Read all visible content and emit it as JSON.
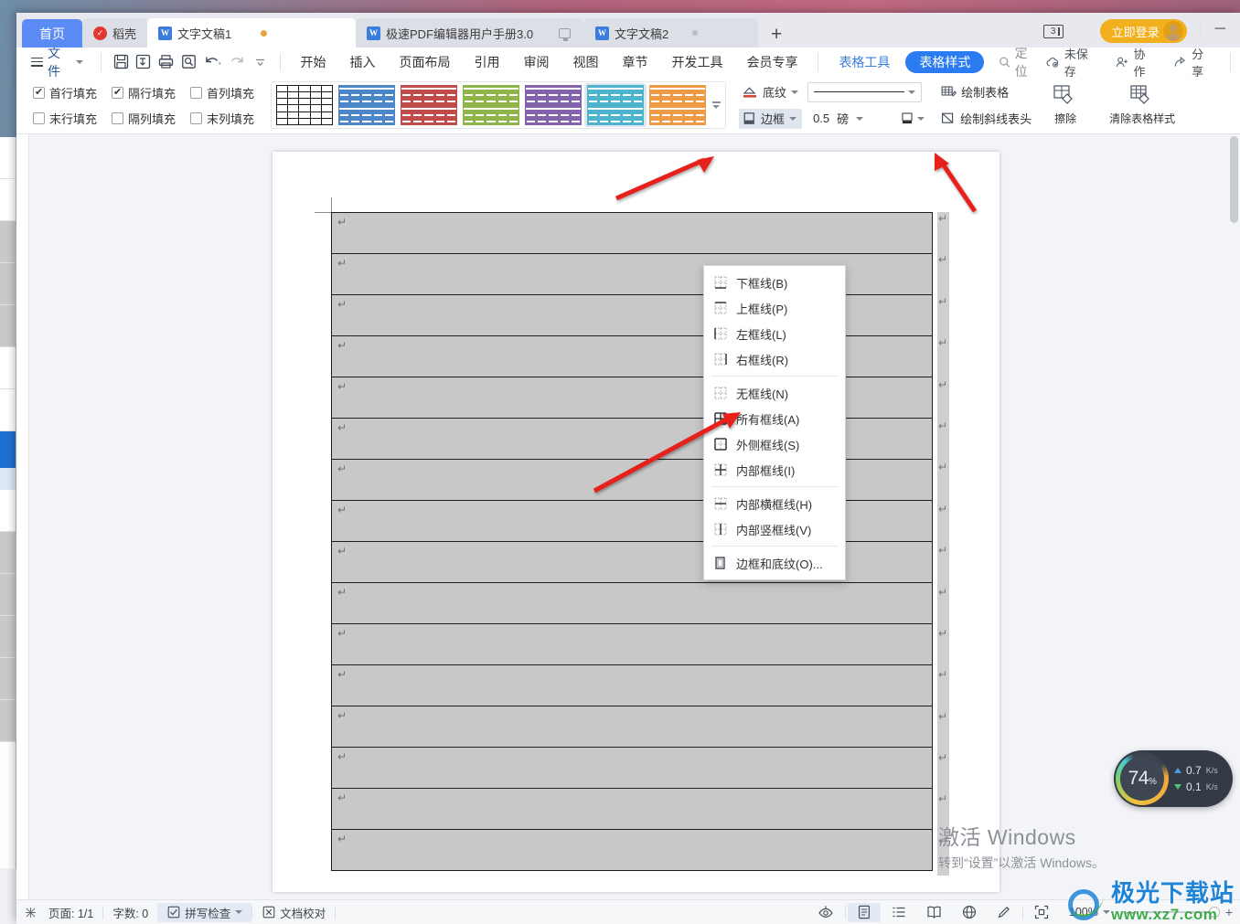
{
  "window": {
    "minimize_label": "─"
  },
  "tabs": {
    "home_label": "首页",
    "items": [
      {
        "label": "稻壳",
        "icon": "docer-icon",
        "state": "plain"
      },
      {
        "label": "文字文稿1",
        "icon": "wps-writer-icon",
        "state": "active",
        "modified": true
      },
      {
        "label": "极速PDF编辑器用户手册3.0",
        "icon": "wps-writer-icon",
        "state": "plain"
      },
      {
        "label": "文字文稿2",
        "icon": "wps-writer-icon",
        "state": "plain"
      }
    ],
    "new_tab_label": "+",
    "tab_count_badge": "3",
    "login_label": "立即登录"
  },
  "menubar": {
    "file_label": "文件",
    "quick_access": [
      "save-icon",
      "save-as-icon",
      "print-icon",
      "print-preview-icon",
      "undo-icon",
      "redo-icon",
      "customize-icon"
    ],
    "items": [
      "开始",
      "插入",
      "页面布局",
      "引用",
      "审阅",
      "视图",
      "章节",
      "开发工具",
      "会员专享"
    ],
    "table_tools_label": "表格工具",
    "table_style_label": "表格样式",
    "locate_label": "定位",
    "right_items": [
      {
        "label": "未保存",
        "icon": "cloud-unsaved-icon"
      },
      {
        "label": "协作",
        "icon": "collaborate-icon"
      },
      {
        "label": "分享",
        "icon": "share-icon"
      }
    ]
  },
  "ribbon": {
    "checkboxes": [
      {
        "label": "首行填充",
        "checked": true
      },
      {
        "label": "隔行填充",
        "checked": true
      },
      {
        "label": "首列填充",
        "checked": false
      },
      {
        "label": "末行填充",
        "checked": false
      },
      {
        "label": "隔列填充",
        "checked": false
      },
      {
        "label": "末列填充",
        "checked": false
      }
    ],
    "gallery": [
      {
        "name": "table-style-plain",
        "color": "#ffffff",
        "selected": false
      },
      {
        "name": "table-style-blue",
        "color": "#4a86c8",
        "selected": false
      },
      {
        "name": "table-style-red",
        "color": "#bf4b4b",
        "selected": false
      },
      {
        "name": "table-style-green",
        "color": "#8fb54a",
        "selected": false
      },
      {
        "name": "table-style-purple",
        "color": "#8263ab",
        "selected": false
      },
      {
        "name": "table-style-teal",
        "color": "#4cb4cc",
        "selected": true
      },
      {
        "name": "table-style-orange",
        "color": "#ef9a44",
        "selected": false
      }
    ],
    "shading_label": "底纹",
    "border_label": "边框",
    "line_width_value": "0.5",
    "line_width_unit": "磅",
    "draw_table_label": "绘制表格",
    "draw_diagonal_label": "绘制斜线表头",
    "erase_label": "擦除",
    "clear_style_label": "清除表格样式"
  },
  "border_menu": {
    "items": [
      {
        "label": "下框线(B)",
        "icon": "border-bottom-icon"
      },
      {
        "label": "上框线(P)",
        "icon": "border-top-icon"
      },
      {
        "label": "左框线(L)",
        "icon": "border-left-icon"
      },
      {
        "label": "右框线(R)",
        "icon": "border-right-icon"
      },
      {
        "sep": true
      },
      {
        "label": "无框线(N)",
        "icon": "border-none-icon"
      },
      {
        "label": "所有框线(A)",
        "icon": "border-all-icon"
      },
      {
        "label": "外侧框线(S)",
        "icon": "border-outside-icon"
      },
      {
        "label": "内部框线(I)",
        "icon": "border-inside-icon"
      },
      {
        "sep": true
      },
      {
        "label": "内部横框线(H)",
        "icon": "border-inside-horizontal-icon"
      },
      {
        "label": "内部竖框线(V)",
        "icon": "border-inside-vertical-icon"
      },
      {
        "sep": true
      },
      {
        "label": "边框和底纹(O)...",
        "icon": "borders-and-shading-icon"
      }
    ]
  },
  "document": {
    "table_row_count": 16,
    "cell_marker": "↵",
    "paragraph_marker": "↵"
  },
  "statusbar": {
    "page_label": "页面: 1/1",
    "word_count_label": "字数: 0",
    "spellcheck_label": "拼写检查",
    "proofread_label": "文档校对",
    "view_icons": [
      "eye-icon",
      "page-view-icon",
      "outline-view-icon",
      "read-view-icon",
      "web-view-icon",
      "pen-icon",
      "fit-page-icon"
    ],
    "zoom_label": "100%",
    "zoom_minus": "─",
    "zoom_plus": "+"
  },
  "net_widget": {
    "cpu_percent": "74",
    "percent_symbol": "%",
    "upload": "0.7",
    "upload_unit": "K/s",
    "download": "0.1",
    "download_unit": "K/s"
  },
  "watermarks": {
    "windows_activate_title": "激活 Windows",
    "windows_activate_sub": "转到“设置”以激活 Windows。",
    "site_cn": "极光下载站",
    "site_en": "www.xz7.com"
  },
  "colors": {
    "accent_blue": "#2b7cf0",
    "tab_home": "#5b8cf5",
    "login_yellow": "#f2b01e",
    "arrow_red": "#e8201b",
    "table_fill": "#c8c8c8"
  }
}
